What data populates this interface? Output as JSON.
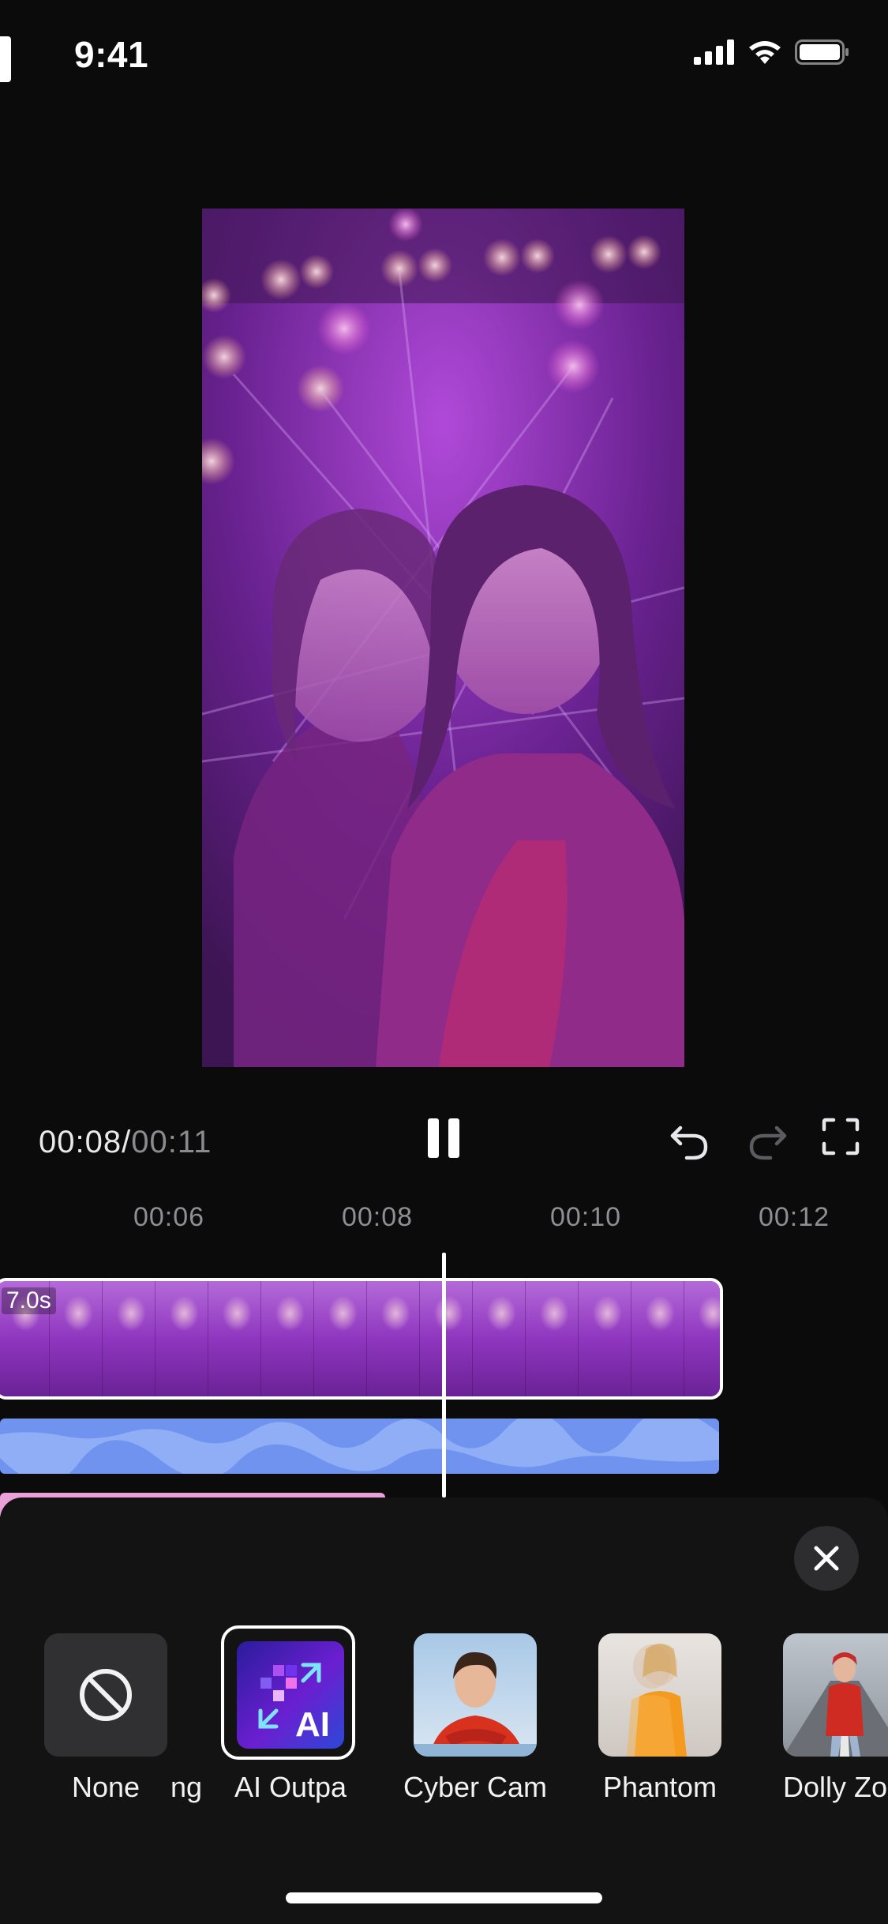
{
  "status_bar": {
    "time": "9:41"
  },
  "player": {
    "current_time": "00:08",
    "separator": "/",
    "total_time": "00:11"
  },
  "ruler": {
    "ticks": [
      "00:06",
      "00:08",
      "00:10",
      "00:12"
    ]
  },
  "clip": {
    "duration": "7.0s"
  },
  "effects": {
    "items": [
      {
        "label": "None",
        "icon": "no-symbol-icon"
      },
      {
        "label": "ng",
        "icon": "partial-effect"
      },
      {
        "label": "AI Outpa",
        "icon": "ai-outpaint-icon",
        "selected": true
      },
      {
        "label": "Cyber Cam",
        "icon": "portrait-thumbnail"
      },
      {
        "label": "Phantom",
        "icon": "motion-blur-thumbnail"
      },
      {
        "label": "Dolly Zoon",
        "icon": "street-thumbnail"
      }
    ]
  },
  "colors": {
    "background": "#0b0b0c",
    "sheet": "#131314",
    "audio_track": "#6f93ef",
    "sticker_track": "#e9a2d7",
    "clip": "#8a2fb8"
  }
}
